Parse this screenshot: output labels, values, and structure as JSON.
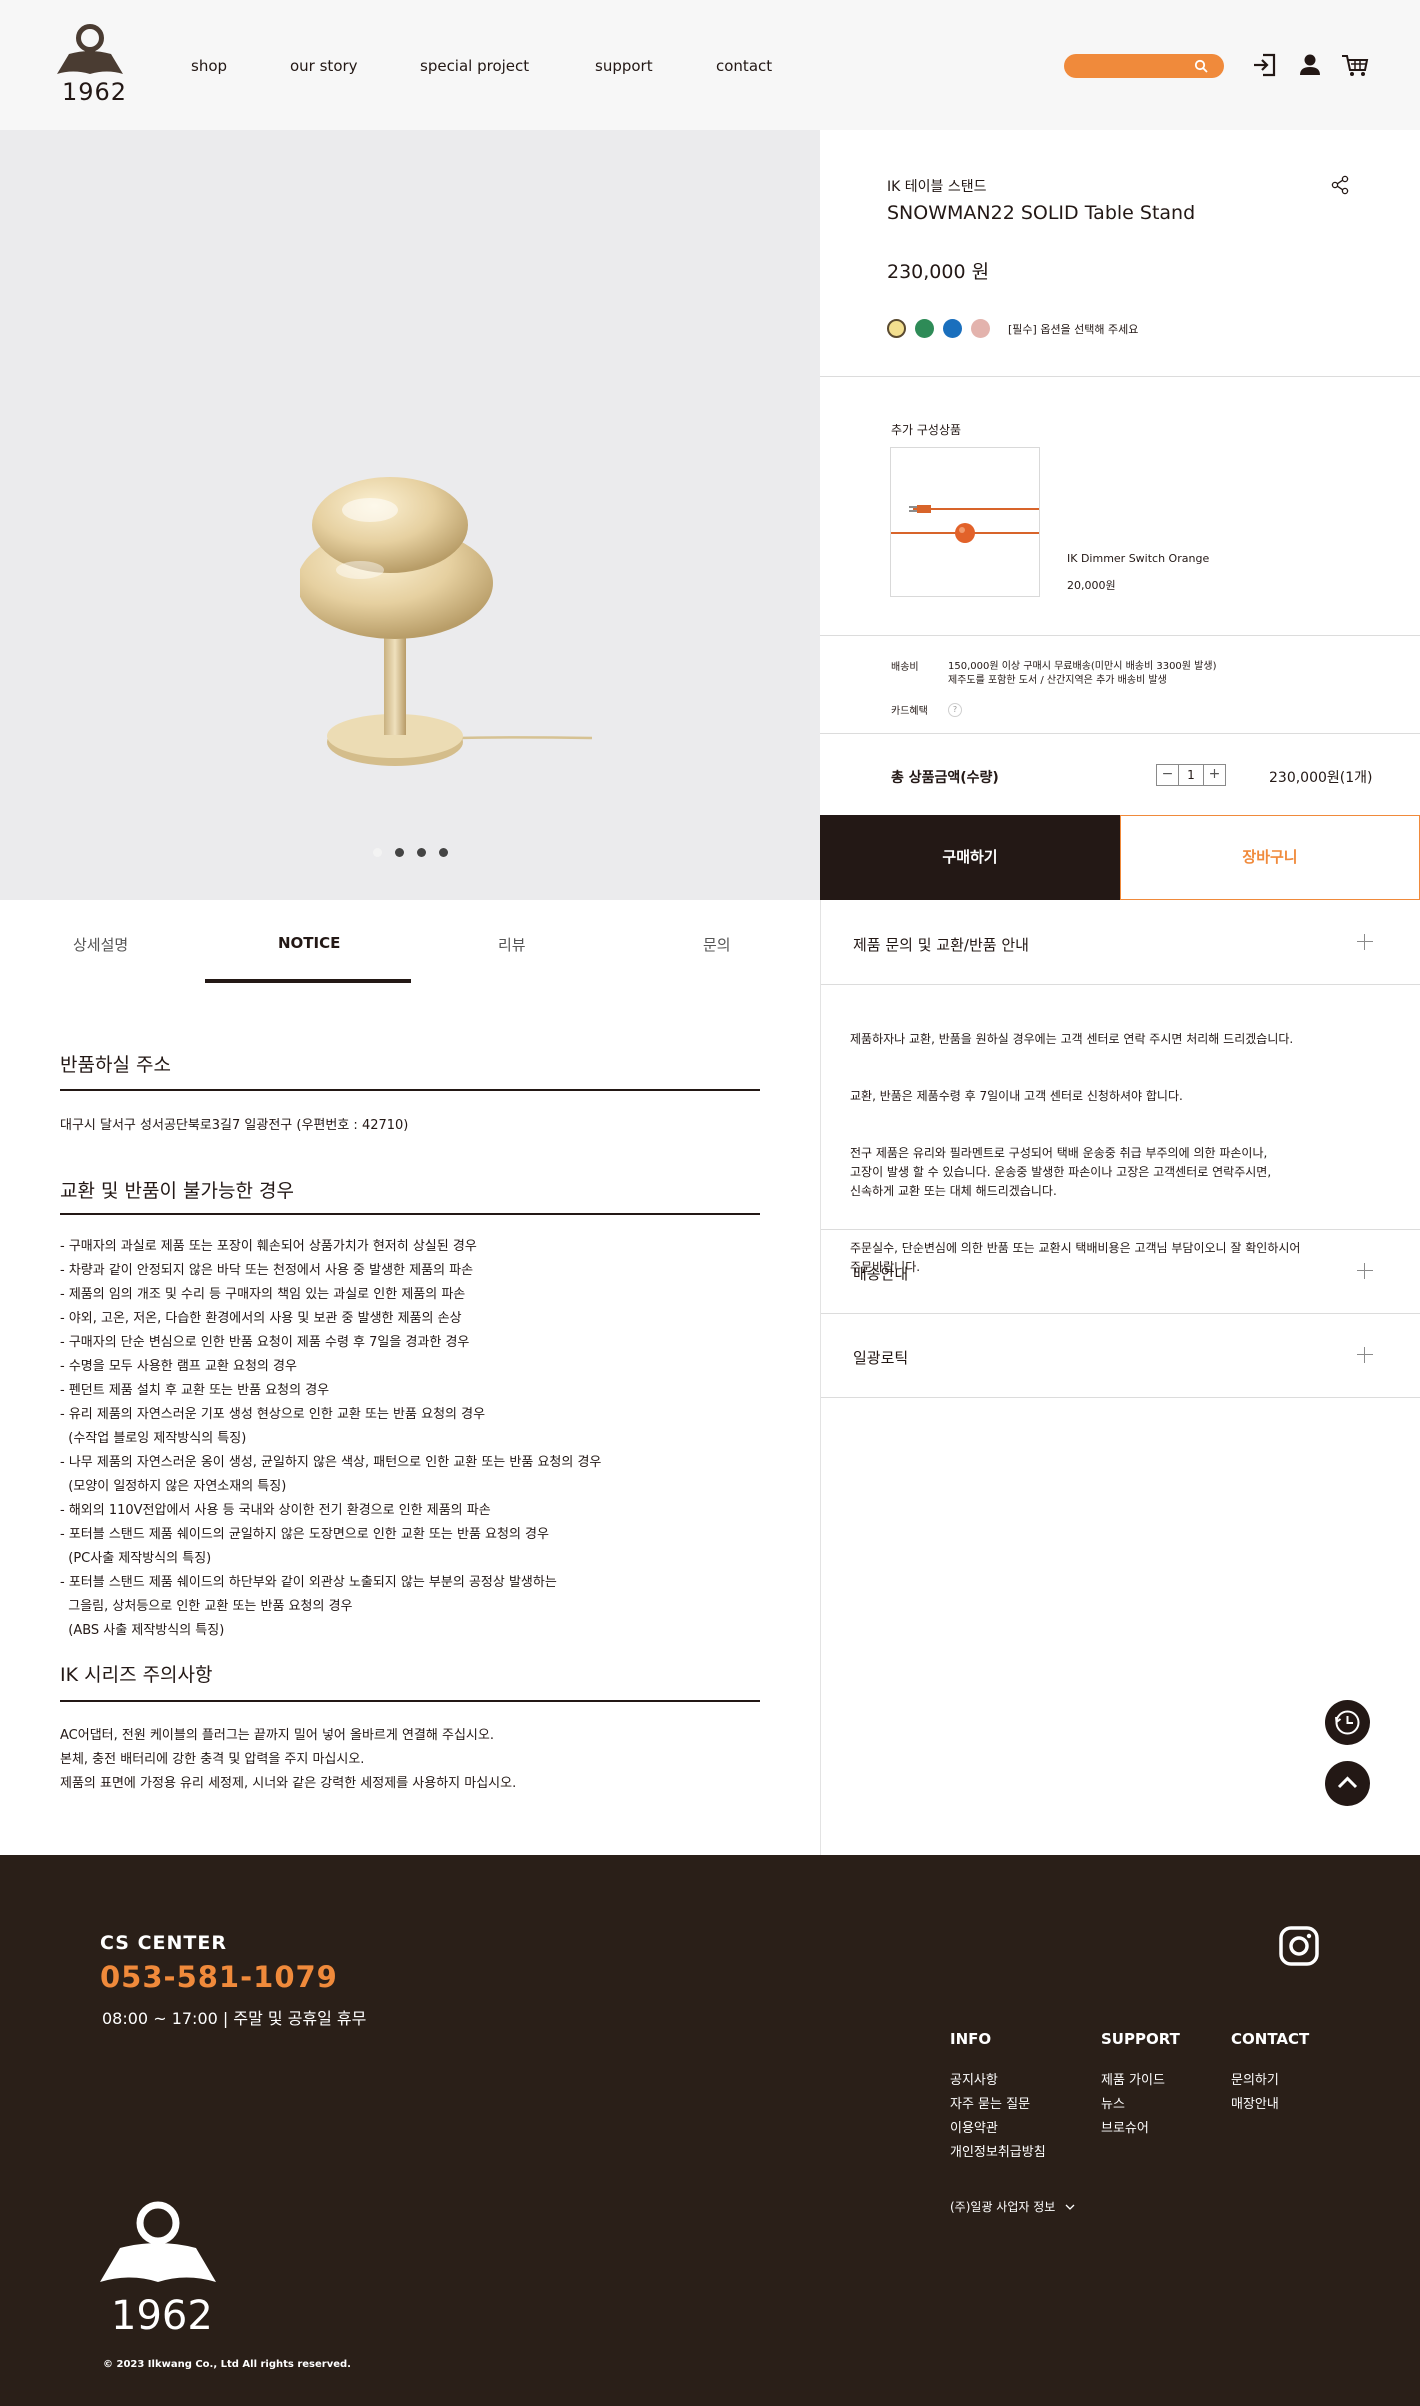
{
  "header": {
    "logo_text": "1962",
    "nav": [
      "shop",
      "our story",
      "special project",
      "support",
      "contact"
    ]
  },
  "product": {
    "category": "IK 테이블 스탠드",
    "name": "SNOWMAN22 SOLID Table Stand",
    "price": "230,000 원",
    "colors": [
      "#f3df8f",
      "#2e8b57",
      "#1a6fbd",
      "#e3b3ad"
    ],
    "option_hint": "[필수] 옵션을 선택해 주세요",
    "carousel_dots": 4
  },
  "addon": {
    "title": "추가 구성상품",
    "name": "IK Dimmer Switch Orange",
    "price": "20,000원"
  },
  "shipping": {
    "label": "배송비",
    "line1": "150,000원 이상 구매시 무료배송(미만시 배송비 3300원 발생)",
    "line2": "제주도를 포함한 도서 / 산간지역은 추가 배송비 발생",
    "card_label": "카드혜택",
    "help": "?"
  },
  "total": {
    "label": "총 상품금액(수량)",
    "qty": "1",
    "minus": "−",
    "plus": "+",
    "price": "230,000원(1개)"
  },
  "buttons": {
    "buy": "구매하기",
    "cart": "장바구니"
  },
  "accordions": {
    "inquiry_title": "제품 문의 및 교환/반품 안내",
    "inquiry_p1": "제품하자나 교환, 반품을 원하실 경우에는 고객 센터로 연락 주시면 처리해 드리겠습니다.",
    "inquiry_p2": "교환, 반품은 제품수령 후 7일이내 고객 센터로 신청하셔야 합니다.",
    "inquiry_p3": "전구 제품은 유리와 필라멘트로 구성되어 택배 운송중 취급 부주의에 의한 파손이나,\n고장이 발생 할 수 있습니다. 운송중 발생한 파손이나 고장은 고객센터로 연락주시면,\n신속하게 교환 또는 대체 해드리겠습니다.",
    "inquiry_p4": "주문실수, 단순변심에 의한 반품 또는 교환시 택배비용은 고객님 부담이오니 잘 확인하시어\n주문바랍니다.",
    "shipping_title": "배송안내",
    "brand_title": "일광로틱"
  },
  "tabs": [
    "상세설명",
    "NOTICE",
    "리뷰",
    "문의"
  ],
  "notice": {
    "return_title": "반품하실 주소",
    "return_address": "대구시 달서구 성서공단북로3길7 일광전구 (우편번호 : 42710)",
    "no_return_title": "교환 및 반품이 불가능한 경우",
    "no_return_items": [
      "- 구매자의 과실로 제품 또는 포장이 훼손되어 상품가치가 현저히 상실된 경우",
      "- 차량과 같이 안정되지 않은 바닥 또는 천정에서 사용 중 발생한 제품의 파손",
      "- 제품의 임의 개조 및 수리 등 구매자의 책임 있는 과실로 인한 제품의 파손",
      "- 야외, 고온, 저온, 다습한 환경에서의 사용 및 보관 중 발생한 제품의 손상",
      "- 구매자의 단순 변심으로 인한 반품 요청이 제품 수령 후 7일을 경과한 경우",
      "- 수명을 모두 사용한 램프 교환 요청의 경우",
      "- 펜던트 제품 설치 후 교환 또는 반품 요청의 경우",
      "- 유리 제품의 자연스러운 기포 생성 현상으로 인한 교환 또는 반품 요청의 경우",
      "  (수작업 블로잉 제작방식의 특징)",
      "- 나무 제품의 자연스러운 옹이 생성, 균일하지 않은 색상, 패턴으로 인한 교환 또는 반품 요청의 경우",
      "  (모양이 일정하지 않은 자연소재의 특징)",
      "- 해외의 110V전압에서 사용 등 국내와 상이한 전기 환경으로 인한 제품의 파손",
      "- 포터블 스탠드 제품 쉐이드의 균일하지 않은 도장면으로 인한 교환 또는 반품 요청의 경우",
      "  (PC사출 제작방식의 특징)",
      "- 포터블 스탠드 제품 쉐이드의 하단부와 같이 외관상 노출되지 않는 부분의 공정상 발생하는",
      "  그을림, 상처등으로 인한 교환 또는 반품 요청의 경우",
      "  (ABS 사출 제작방식의 특징)"
    ],
    "caution_title": "IK 시리즈 주의사항",
    "caution_items": [
      "AC어댑터, 전원 케이블의 플러그는 끝까지 밀어 넣어 올바르게 연결해 주십시오.",
      "본체, 충전 배터리에 강한 충격 및 압력을 주지 마십시오.",
      "제품의 표면에 가정용 유리 세정제, 시너와 같은 강력한 세정제를 사용하지 마십시오."
    ]
  },
  "footer": {
    "cs_title": "CS  CENTER",
    "cs_phone": "053-581-1079",
    "cs_hours": "08:00 ~ 17:00  |  주말 및 공휴일 휴무",
    "info_title": "INFO",
    "info_links": [
      "공지사항",
      "자주 묻는 질문",
      "이용약관",
      "개인정보취급방침"
    ],
    "support_title": "SUPPORT",
    "support_links": [
      "제품 가이드",
      "뉴스",
      "브로슈어"
    ],
    "contact_title": "CONTACT",
    "contact_links": [
      "문의하기",
      "매장안내"
    ],
    "biz_info": "(주)일광 사업자 정보",
    "logo_text": "1962",
    "copyright": "© 2023 Ilkwang Co., Ltd All rights reserved."
  },
  "colors": {
    "brand_dark": "#231815",
    "accent_orange": "#f08a3b",
    "footer_bg": "#2a1f18"
  }
}
